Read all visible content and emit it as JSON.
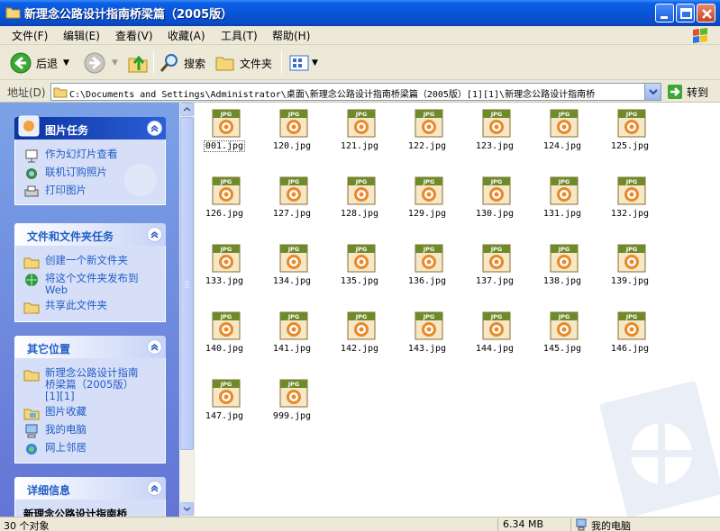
{
  "window": {
    "title": "新理念公路设计指南桥梁篇（2005版）"
  },
  "menu": [
    "文件(F)",
    "编辑(E)",
    "查看(V)",
    "收藏(A)",
    "工具(T)",
    "帮助(H)"
  ],
  "toolbar": {
    "back_label": "后退",
    "search_label": "搜索",
    "folders_label": "文件夹"
  },
  "address": {
    "label": "地址(D)",
    "path": "C:\\Documents and Settings\\Administrator\\桌面\\新理念公路设计指南桥梁篇（2005版）[1][1]\\新理念公路设计指南桥",
    "go_label": "转到"
  },
  "panels": {
    "picture_tasks": {
      "title": "图片任务",
      "items": [
        "作为幻灯片查看",
        "联机订购照片",
        "打印图片"
      ]
    },
    "file_tasks": {
      "title": "文件和文件夹任务",
      "items": [
        {
          "lines": [
            "创建一个新文件夹"
          ]
        },
        {
          "lines": [
            "将这个文件夹发布到",
            "Web"
          ]
        },
        {
          "lines": [
            "共享此文件夹"
          ]
        }
      ]
    },
    "other_places": {
      "title": "其它位置",
      "items": [
        {
          "lines": [
            "新理念公路设计指南",
            "桥梁篇（2005版）",
            "[1][1]"
          ]
        },
        {
          "lines": [
            "图片收藏"
          ]
        },
        {
          "lines": [
            "我的电脑"
          ]
        },
        {
          "lines": [
            "网上邻居"
          ]
        }
      ]
    },
    "details": {
      "title": "详细信息",
      "peek": "新理念公路设计指南桥"
    }
  },
  "files": [
    "001.jpg",
    "120.jpg",
    "121.jpg",
    "122.jpg",
    "123.jpg",
    "124.jpg",
    "125.jpg",
    "126.jpg",
    "127.jpg",
    "128.jpg",
    "129.jpg",
    "130.jpg",
    "131.jpg",
    "132.jpg",
    "133.jpg",
    "134.jpg",
    "135.jpg",
    "136.jpg",
    "137.jpg",
    "138.jpg",
    "139.jpg",
    "140.jpg",
    "141.jpg",
    "142.jpg",
    "143.jpg",
    "144.jpg",
    "145.jpg",
    "146.jpg",
    "147.jpg",
    "999.jpg"
  ],
  "selected_file": "001.jpg",
  "jpg_badge": "JPG",
  "status": {
    "count": "30 个对象",
    "size": "6.34 MB",
    "zone": "我的电脑"
  },
  "colors": {
    "titlebar": "#0a55d8",
    "taskpane": "#6d8fe0",
    "link": "#215dc6"
  }
}
